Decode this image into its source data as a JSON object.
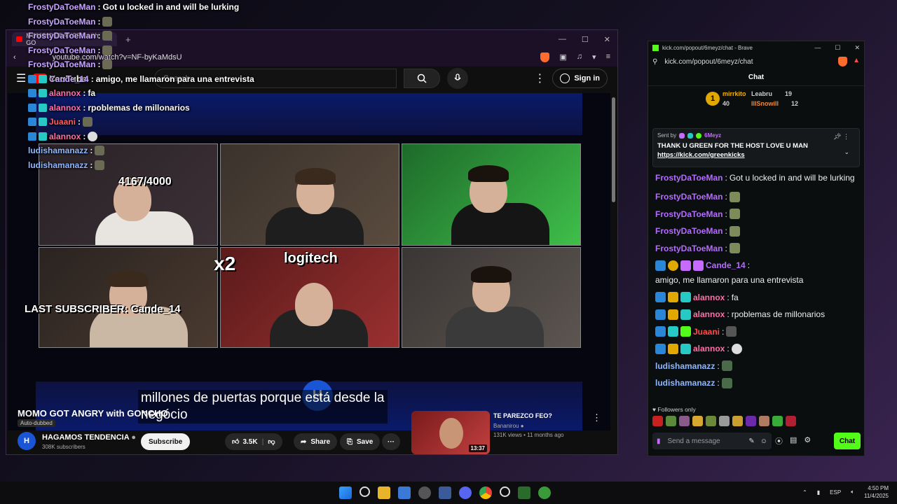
{
  "overlay_chat": [
    {
      "user": "FrostyDaToeMan",
      "text": "Got u locked in and will be lurking"
    },
    {
      "user": "FrostyDaToeMan",
      "text": ""
    },
    {
      "user": "FrostyDaToeMan",
      "text": ""
    },
    {
      "user": "FrostyDaToeMan",
      "text": ""
    },
    {
      "user": "FrostyDaToeMan",
      "text": ""
    },
    {
      "user": "Cande_14",
      "text": "amigo, me llamaron para una entrevista"
    },
    {
      "user": "alannox",
      "text": "fa"
    },
    {
      "user": "alannox",
      "text": "rpoblemas de millonarios"
    },
    {
      "user": "Juaani",
      "text": ""
    },
    {
      "user": "alannox",
      "text": ""
    },
    {
      "user": "ludishamanazz",
      "text": ""
    },
    {
      "user": "ludishamanazz",
      "text": ""
    }
  ],
  "youtube": {
    "tab_title": "MOMO GOT ANGRY with GO",
    "url": "youtube.com/watch?v=NF-byKaMdsU",
    "logo": "YouTube",
    "search_placeholder": "Search",
    "sign_in": "Sign in",
    "video_overlay": {
      "sub_goal": "4167/4000",
      "multiplier": "x2",
      "last_subscriber": "LAST SUBSCRIBER: Cande_14",
      "brand": "logitech"
    },
    "subtitles": [
      "millones de puertas porque está desde la",
      "negócio"
    ],
    "channel_mark": "H",
    "video_title": "MOMO GOT ANGRY with GONCHO",
    "auto_dubbed": "Auto-dubbed",
    "channel_avatar": "H",
    "channel_name": "HAGAMOS TENDENCIA",
    "channel_subs": "308K subscribers",
    "subscribe": "Subscribe",
    "likes": "3.5K",
    "share": "Share",
    "save": "Save",
    "more": "···",
    "recommended": {
      "title": "TE PAREZCO FEO?",
      "channel": "Bananirou",
      "meta": "131K views • 11 months ago",
      "duration": "13:37"
    }
  },
  "kick": {
    "window_title": "kick.com/popout/6meyz/chat - Brave",
    "url": "kick.com/popout/6meyz/chat",
    "header": "Chat",
    "leaderboard": {
      "rank": "1",
      "first": {
        "name": "mirrkito",
        "count": "40"
      },
      "second": {
        "name": "Leabru",
        "count": "19"
      },
      "third": {
        "name": "IllSnowill",
        "count": "12"
      }
    },
    "pinned": {
      "sent_by": "Sent by",
      "sender": "6Meyz",
      "message": "THANK U GREEN FOR THE HOST LOVE U MAN",
      "link": "https://kick.com/greenkicks"
    },
    "messages": [
      {
        "user": "FrostyDaToeMan",
        "text": "Got u locked in and will be lurking",
        "color": "purple"
      },
      {
        "user": "FrostyDaToeMan",
        "text": "",
        "color": "purple"
      },
      {
        "user": "FrostyDaToeMan",
        "text": "",
        "color": "purple"
      },
      {
        "user": "FrostyDaToeMan",
        "text": "",
        "color": "purple"
      },
      {
        "user": "FrostyDaToeMan",
        "text": "",
        "color": "purple"
      },
      {
        "user": "Cande_14",
        "text": "amigo, me llamaron para una entrevista",
        "color": "purple"
      },
      {
        "user": "alannox",
        "text": "fa",
        "color": "pink"
      },
      {
        "user": "alannox",
        "text": "rpoblemas de millonarios",
        "color": "pink"
      },
      {
        "user": "Juaani",
        "text": "",
        "color": "red"
      },
      {
        "user": "alannox",
        "text": "",
        "color": "pink"
      },
      {
        "user": "ludishamanazz",
        "text": "",
        "color": "blue"
      },
      {
        "user": "ludishamanazz",
        "text": "",
        "color": "blue"
      }
    ],
    "followers_only": "Followers only",
    "input_placeholder": "Send a message",
    "chat_button": "Chat",
    "accent": "#53fc18"
  },
  "taskbar": {
    "language": "ESP",
    "time": "4:50 PM",
    "date": "11/4/2025"
  }
}
